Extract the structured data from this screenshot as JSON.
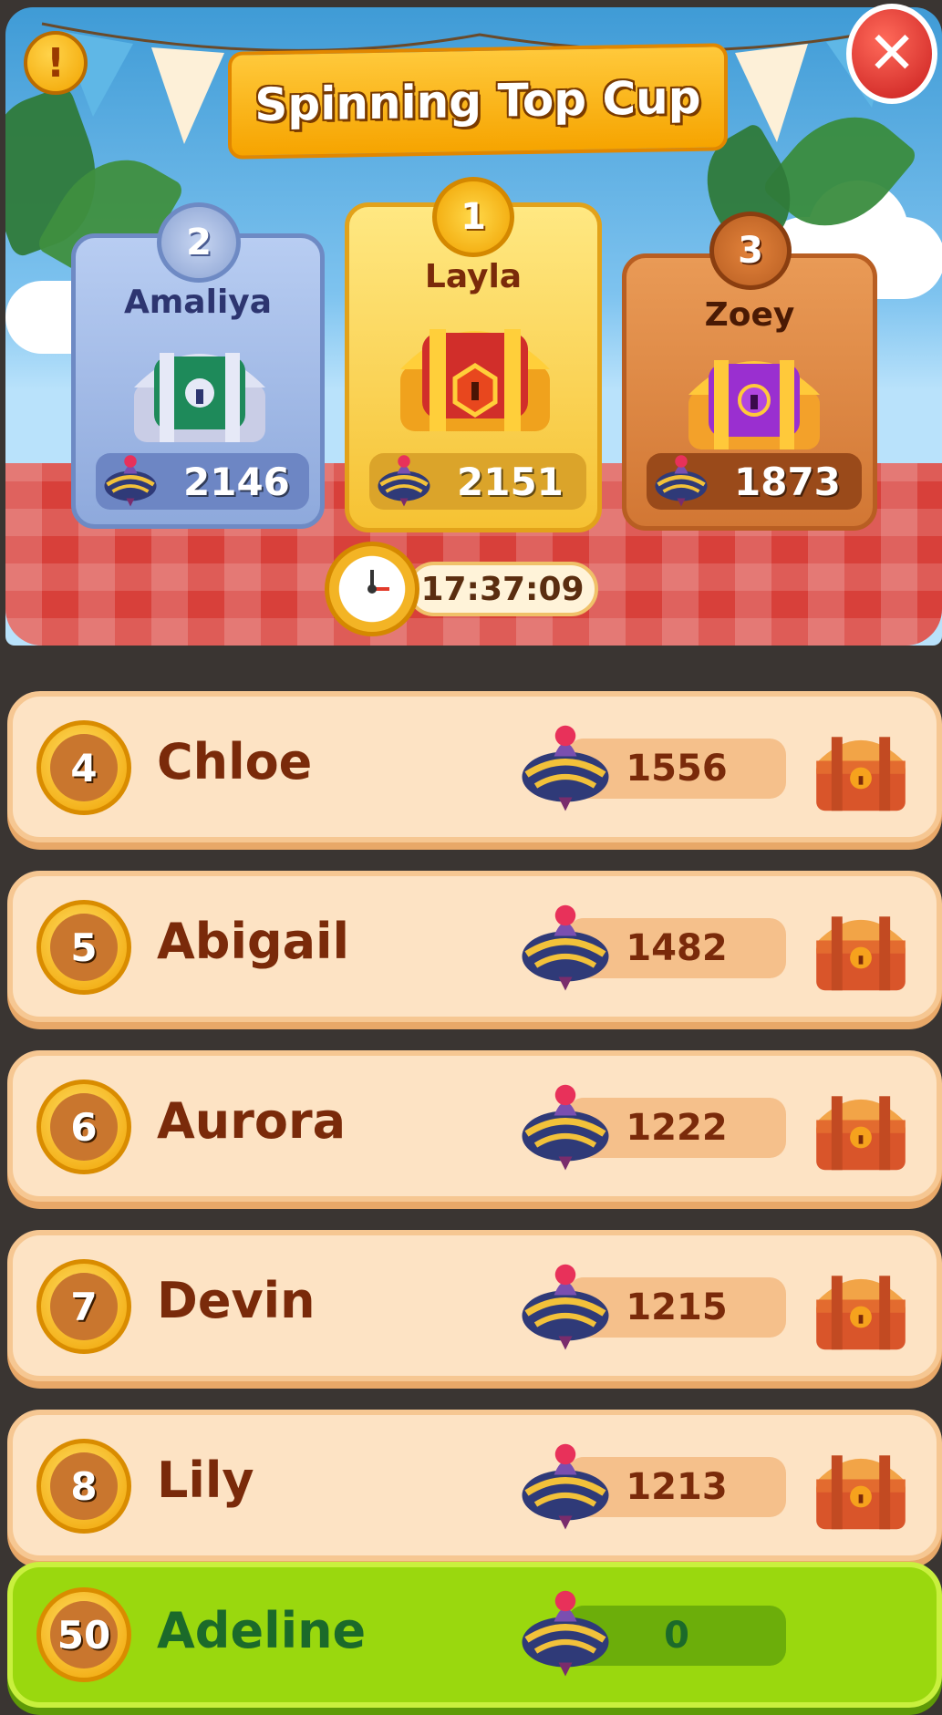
{
  "event": {
    "title": "Spinning Top Cup",
    "timer": "17:37:09",
    "info_icon": "!",
    "close_icon": "✕"
  },
  "podium": [
    {
      "rank": "2",
      "name": "Amaliya",
      "score": "2146",
      "chest": "silver-green-chest"
    },
    {
      "rank": "1",
      "name": "Layla",
      "score": "2151",
      "chest": "gold-red-chest"
    },
    {
      "rank": "3",
      "name": "Zoey",
      "score": "1873",
      "chest": "orange-purple-chest"
    }
  ],
  "leaderboard": [
    {
      "rank": "4",
      "name": "Chloe",
      "score": "1556"
    },
    {
      "rank": "5",
      "name": "Abigail",
      "score": "1482"
    },
    {
      "rank": "6",
      "name": "Aurora",
      "score": "1222"
    },
    {
      "rank": "7",
      "name": "Devin",
      "score": "1215"
    },
    {
      "rank": "8",
      "name": "Lily",
      "score": "1213"
    }
  ],
  "current_player": {
    "rank": "50",
    "name": "Adeline",
    "score": "0"
  },
  "colors": {
    "silver_card": "#9eb6e6",
    "gold_card": "#ffd64a",
    "bronze_card": "#d8823f",
    "row_bg": "#fde3c4",
    "me_row_bg": "#9ad80e"
  }
}
